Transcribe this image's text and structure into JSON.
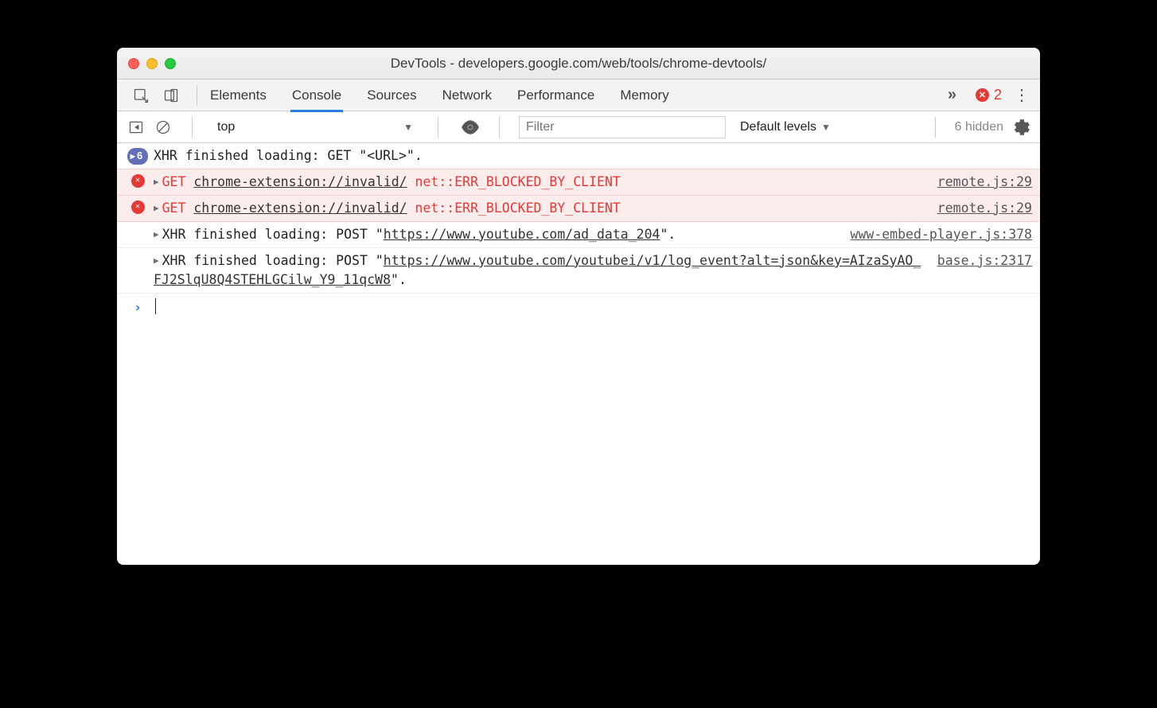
{
  "window": {
    "title": "DevTools - developers.google.com/web/tools/chrome-devtools/"
  },
  "tabs": {
    "items": [
      "Elements",
      "Console",
      "Sources",
      "Network",
      "Performance",
      "Memory"
    ],
    "active": "Console",
    "overflow": "»",
    "error_count": "2"
  },
  "toolbar": {
    "context": "top",
    "filter_placeholder": "Filter",
    "levels": "Default levels",
    "hidden": "6 hidden"
  },
  "messages": [
    {
      "type": "xhr-group",
      "count": "6",
      "text": "XHR finished loading: GET \"<URL>\"."
    },
    {
      "type": "error",
      "method": "GET",
      "url": "chrome-extension://invalid/",
      "err": "net::ERR_BLOCKED_BY_CLIENT",
      "src": "remote.js:29"
    },
    {
      "type": "error",
      "method": "GET",
      "url": "chrome-extension://invalid/",
      "err": "net::ERR_BLOCKED_BY_CLIENT",
      "src": "remote.js:29"
    },
    {
      "type": "xhr",
      "pre": "XHR finished loading: POST \"",
      "url": "https://www.youtube.com/ad_data_204",
      "post": "\".",
      "src": "www-embed-player.js:378"
    },
    {
      "type": "xhr",
      "pre": "XHR finished loading: POST \"",
      "url": "https://www.youtube.com/youtubei/v1/log_event?alt=json&key=AIzaSyAO_FJ2SlqU8Q4STEHLGCilw_Y9_11qcW8",
      "post": "\".",
      "src": "base.js:2317"
    }
  ],
  "prompt": "›"
}
